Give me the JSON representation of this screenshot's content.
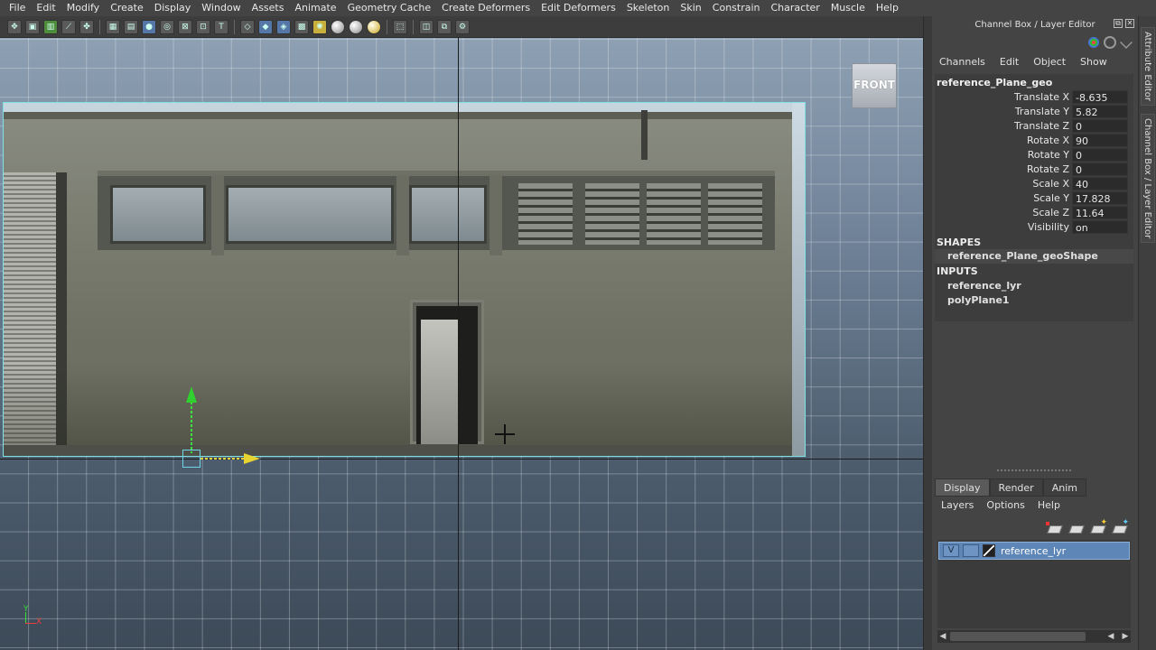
{
  "menubar": {
    "items": [
      "File",
      "Edit",
      "Modify",
      "Create",
      "Display",
      "Window",
      "Assets",
      "Animate",
      "Geometry Cache",
      "Create Deformers",
      "Edit Deformers",
      "Skeleton",
      "Skin",
      "Constrain",
      "Character",
      "Muscle",
      "Help"
    ]
  },
  "viewport": {
    "view_label": "FRONT"
  },
  "channel_box": {
    "title": "Channel Box / Layer Editor",
    "menu": [
      "Channels",
      "Edit",
      "Object",
      "Show"
    ],
    "object_name": "reference_Plane_geo",
    "attributes": [
      {
        "label": "Translate X",
        "value": "-8.635"
      },
      {
        "label": "Translate Y",
        "value": "5.82"
      },
      {
        "label": "Translate Z",
        "value": "0"
      },
      {
        "label": "Rotate X",
        "value": "90"
      },
      {
        "label": "Rotate Y",
        "value": "0"
      },
      {
        "label": "Rotate Z",
        "value": "0"
      },
      {
        "label": "Scale X",
        "value": "40"
      },
      {
        "label": "Scale Y",
        "value": "17.828"
      },
      {
        "label": "Scale Z",
        "value": "11.64"
      },
      {
        "label": "Visibility",
        "value": "on"
      }
    ],
    "shapes_header": "SHAPES",
    "shape_name": "reference_Plane_geoShape",
    "inputs_header": "INPUTS",
    "inputs": [
      "reference_lyr",
      "polyPlane1"
    ]
  },
  "layer_editor": {
    "tabs": [
      "Display",
      "Render",
      "Anim"
    ],
    "active_tab": "Display",
    "menu": [
      "Layers",
      "Options",
      "Help"
    ],
    "layer": {
      "visibility": "V",
      "name": "reference_lyr"
    }
  },
  "side_tabs": [
    "Attribute Editor",
    "Channel Box / Layer Editor"
  ],
  "axis_gizmo": {
    "y": "Y",
    "x": "X"
  },
  "colors": {
    "selection": "#5e87b8",
    "wireframe_highlight": "#7fe3e3",
    "y_axis": "#36e036",
    "x_axis": "#ec3e3e",
    "manipulator_x": "#e8d431"
  }
}
